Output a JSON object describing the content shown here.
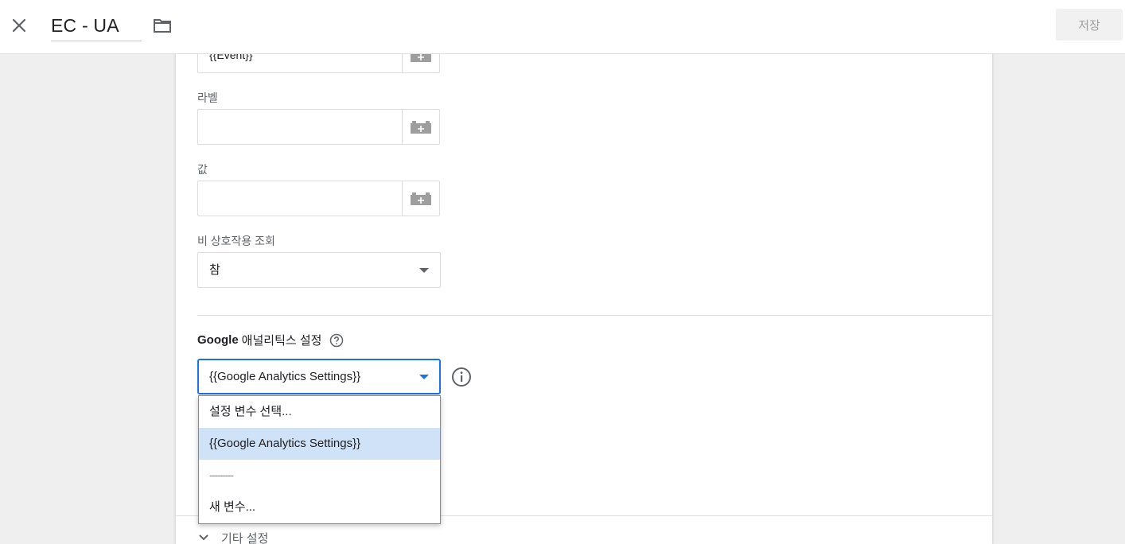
{
  "topbar": {
    "title": "EC - UA",
    "save_label": "저장"
  },
  "fields": {
    "action_value": "{{Event}}",
    "label_caption": "라벨",
    "label_value": "",
    "value_caption": "값",
    "value_value": "",
    "non_interaction_caption": "비 상호작용 조회",
    "non_interaction_value": "참"
  },
  "ga_settings": {
    "title_brand": "Google",
    "title_rest": "애널리틱스 설정",
    "selected": "{{Google Analytics Settings}}",
    "options": [
      "설정 변수 선택...",
      "{{Google Analytics Settings}}",
      "---------",
      "새 변수..."
    ],
    "selected_index": 1
  },
  "more_settings_label": "기타 설정",
  "icons": {
    "close": "close-icon",
    "folder": "folder-icon",
    "variable": "add-variable-icon",
    "help": "help-icon",
    "info": "info-icon",
    "expand": "chevron-down-icon"
  },
  "colors": {
    "accent": "#1a73e8",
    "selected_option_bg": "#cfe2f7",
    "page_bg": "#efefef"
  }
}
